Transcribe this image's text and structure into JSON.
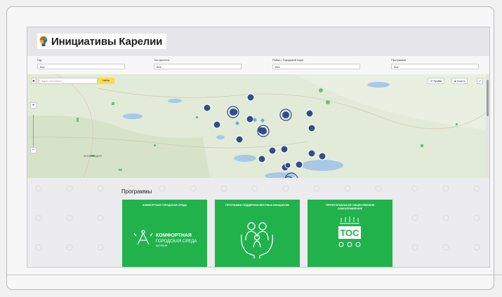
{
  "app": {
    "title": "Инициативы Карелии"
  },
  "filters": [
    {
      "label": "Год",
      "value": "Все"
    },
    {
      "label": "Тип проекта",
      "value": "Все"
    },
    {
      "label": "Район / Городской округ",
      "value": "Все"
    },
    {
      "label": "Программа",
      "value": "Все"
    }
  ],
  "map": {
    "search_placeholder": "Адрес или объект",
    "search_button": "Найти",
    "traffic_label": "Пробки",
    "layers_label": "Слои",
    "zoom_in": "+",
    "zoom_out": "−",
    "region_label": "ФИНЛЯНДИЯ"
  },
  "programs": {
    "title": "Программы",
    "cards": [
      {
        "title": "КОМФОРТНАЯ ГОРОДСКАЯ СРЕДА",
        "logo_line1": "КОМФОРТНАЯ",
        "logo_line2": "ГОРОДСКАЯ СРЕДА",
        "logo_line3": "КАРЕЛИЯ"
      },
      {
        "title": "ПРОГРАММА ПОДДЕРЖКИ МЕСТНЫХ ИНИЦИАТИВ"
      },
      {
        "title": "ТЕРРИТОРИАЛЬНОЕ ОБЩЕСТВЕННОЕ САМОУПРАВЛЕНИЕ",
        "logo_text": "ТОС"
      }
    ]
  },
  "colors": {
    "accent_green": "#22b24c",
    "marker_blue": "#2f4e8a",
    "search_yellow": "#ffdb4d"
  }
}
